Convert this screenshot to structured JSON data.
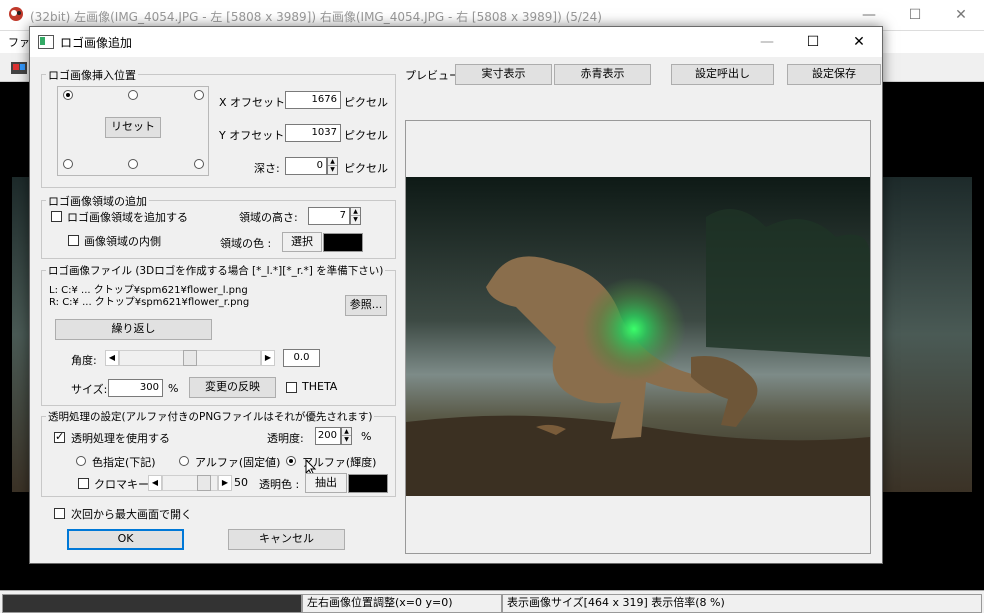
{
  "window": {
    "title": "(32bit) 左画像(IMG_4054.JPG - 左 [5808 x 3989]) 右画像(IMG_4054.JPG - 右 [5808 x 3989]) (5/24)",
    "minimize": "—",
    "maximize": "☐",
    "close": "✕",
    "menu_first": "ファイ"
  },
  "status": {
    "adjust": "左右画像位置調整(x=0 y=0)",
    "size": "表示画像サイズ[464 x 319]  表示倍率(8 %)"
  },
  "dialog": {
    "title": "ロゴ画像追加",
    "minimize": "—",
    "maximize": "☐",
    "close": "✕",
    "position": {
      "legend": "ロゴ画像挿入位置",
      "reset": "リセット",
      "x_label": "X オフセット:",
      "x_value": "1676",
      "x_unit": "ピクセル",
      "y_label": "Y オフセット:",
      "y_value": "1037",
      "y_unit": "ピクセル",
      "depth_label": "深さ:",
      "depth_value": "0",
      "depth_unit": "ピクセル",
      "selected_anchor": "top-left"
    },
    "region": {
      "legend": "ロゴ画像領域の追加",
      "add_region": "ロゴ画像領域を追加する",
      "inside": "画像領域の内側",
      "height_label": "領域の高さ:",
      "height_value": "7",
      "color_label": "領域の色 :",
      "select": "選択",
      "color": "#000000"
    },
    "file": {
      "legend": "ロゴ画像ファイル (3Dロゴを作成する場合 [*_l.*][*_r.*] を準備下さい)",
      "left": "L: C:¥ ... クトップ¥spm621¥flower_l.png",
      "right": "R: C:¥ ... クトップ¥spm621¥flower_r.png",
      "browse": "参照...",
      "repeat": "繰り返し",
      "angle_label": "角度:",
      "angle_value": "0.0",
      "angle_fraction": 0.5,
      "size_label": "サイズ:",
      "size_value": "300",
      "size_unit": "%",
      "apply": "変更の反映",
      "theta": "THETA"
    },
    "transparency": {
      "legend": "透明処理の設定(アルファ付きのPNGファイルはそれが優先されます)",
      "use": "透明処理を使用する",
      "opacity_label": "透明度:",
      "opacity_value": "200",
      "opacity_unit": "%",
      "mode_color": "色指定(下記)",
      "mode_alpha_fixed": "アルファ(固定値)",
      "mode_alpha_luma": "アルファ(輝度)",
      "chroma": "クロマキー",
      "chroma_value": "50",
      "chroma_fraction": 0.85,
      "trans_color_label": "透明色 :",
      "extract": "抽出",
      "trans_color": "#000000"
    },
    "open_max": "次回から最大画面で開く",
    "ok": "OK",
    "cancel": "キャンセル",
    "preview": {
      "label": "プレビュー",
      "actual": "実寸表示",
      "anaglyph": "赤青表示",
      "load_settings": "設定呼出し",
      "save_settings": "設定保存"
    }
  }
}
